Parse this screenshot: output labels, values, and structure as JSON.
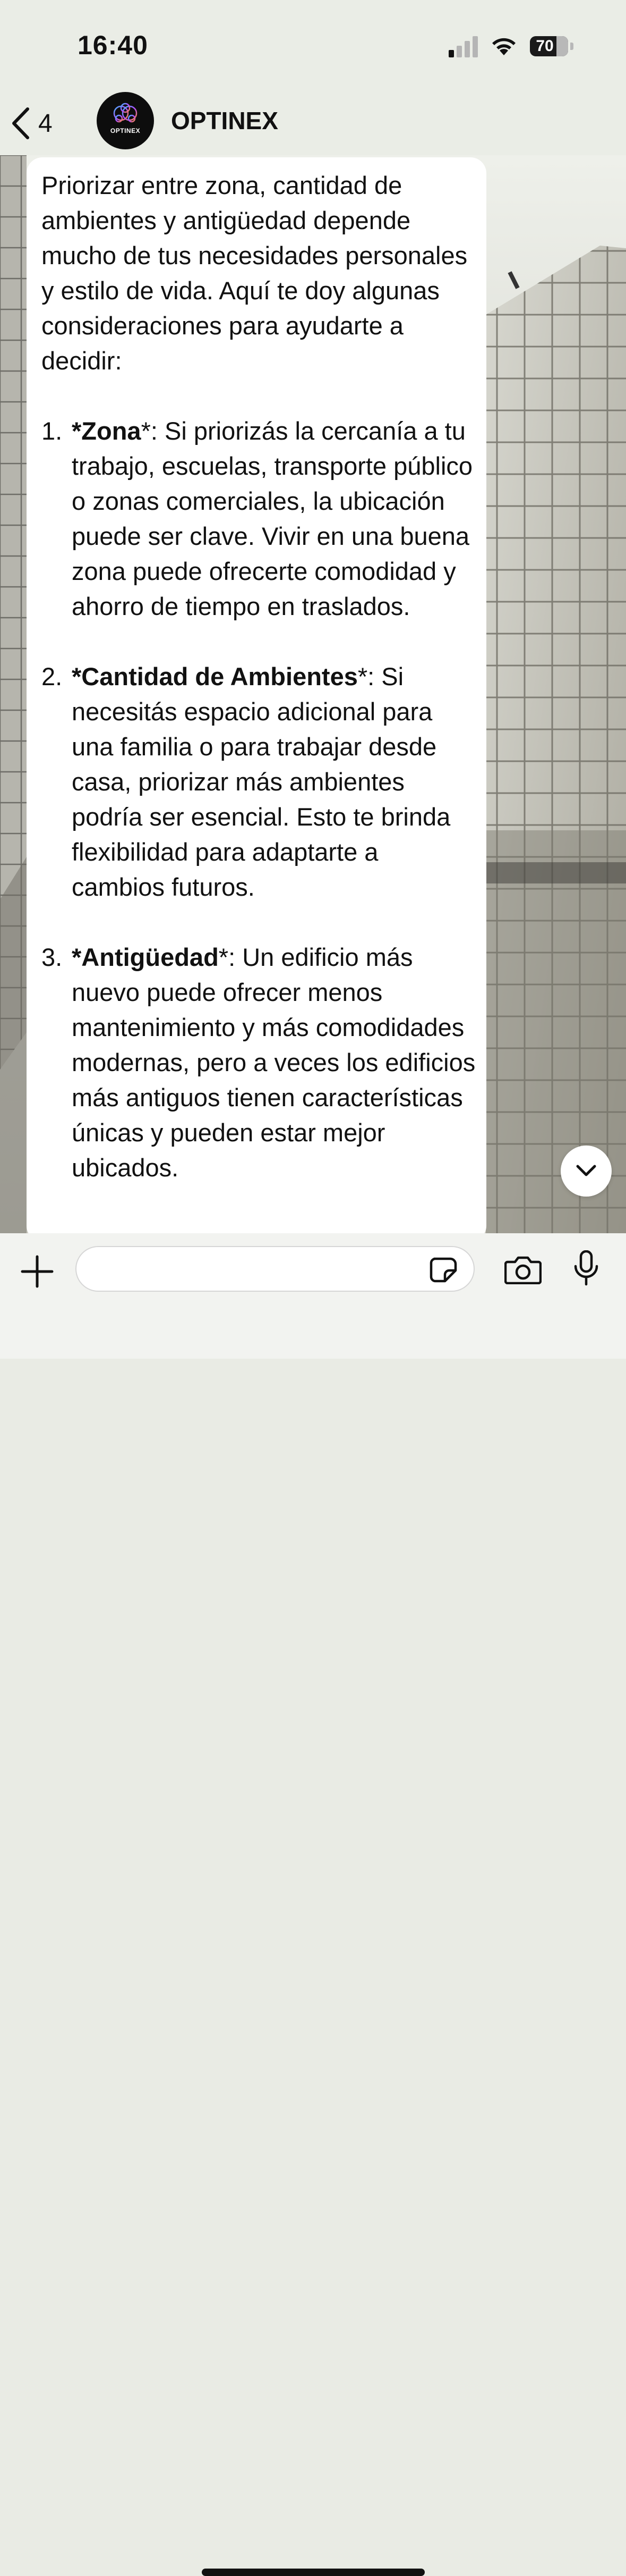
{
  "status_bar": {
    "time": "16:40",
    "battery_level": "70"
  },
  "header": {
    "back_count": "4",
    "avatar_label": "OPTINEX",
    "contact_name": "OPTINEX"
  },
  "message": {
    "intro": "Priorizar entre zona, cantidad de ambientes y antigüedad depende mucho de tus necesidades personales y estilo de vida. Aquí te doy algunas consideraciones para ayudarte a decidir:",
    "items": [
      {
        "number": "1.",
        "star_open": "*",
        "title": "Zona",
        "star_close": "*",
        "body": ": Si priorizás la cercanía a tu trabajo, escuelas, transporte público o zonas comerciales, la ubicación puede ser clave. Vivir en una buena zona puede ofrecerte comodidad y ahorro de tiempo en traslados."
      },
      {
        "number": "2.",
        "star_open": "*",
        "title": "Cantidad de Ambientes",
        "star_close": "*",
        "body": ": Si necesitás espacio adicional para una familia o para trabajar desde casa, priorizar más ambientes podría ser esencial. Esto te brinda flexibilidad para adaptarte a cambios futuros."
      },
      {
        "number": "3.",
        "star_open": "*",
        "title": "Antigüedad",
        "star_close": "*",
        "body": ": Un edificio más nuevo puede ofrecer menos mantenimiento y más comodidades modernas, pero a veces los edificios más antiguos tienen características únicas y pueden estar mejor ubicados."
      }
    ]
  },
  "input": {
    "placeholder": "",
    "value": ""
  },
  "icons": {
    "back": "chevron-left-icon",
    "scroll_down": "chevron-down-icon",
    "plus": "plus-icon",
    "sticker": "sticker-icon",
    "camera": "camera-icon",
    "mic": "microphone-icon"
  },
  "colors": {
    "bubble": "#ffffff",
    "header_bg": "#eaede6",
    "input_bar_bg": "#f2f3f0",
    "text": "#111111"
  }
}
